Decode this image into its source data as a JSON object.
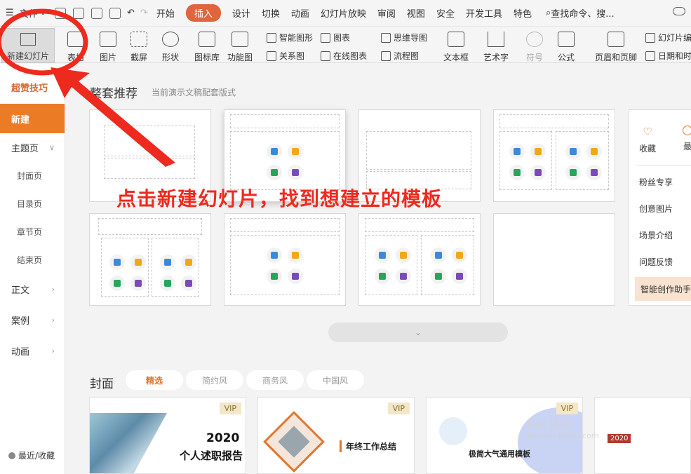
{
  "menubar": {
    "hamburger_label": "文件",
    "tabs": [
      "开始",
      "插入",
      "设计",
      "切换",
      "动画",
      "幻灯片放映",
      "审阅",
      "视图",
      "安全",
      "开发工具",
      "特色"
    ],
    "active_tab": "插入",
    "search_label": "查找命令、搜..."
  },
  "ribbon": {
    "new_slide": "新建幻灯片",
    "table": "表格",
    "picture": "图片",
    "screenshot": "截屏",
    "shape": "形状",
    "icon_lib": "图标库",
    "function_chart": "功能图",
    "smart_shape": "智能图形",
    "relation": "关系图",
    "chart": "图表",
    "online_chart": "在线图表",
    "mindmap": "思维导图",
    "flowchart": "流程图",
    "textbox": "文本框",
    "art_text": "艺术字",
    "symbol": "符号",
    "formula": "公式",
    "header_footer": "页眉和页脚",
    "slide_num": "幻灯片编",
    "date_time": "日期和时"
  },
  "sidebar": {
    "head": "超赞技巧",
    "new": "新建",
    "theme_page": "主题页",
    "subs": [
      "封面页",
      "目录页",
      "章节页",
      "结束页"
    ],
    "body": "正文",
    "case": "案例",
    "animation": "动画",
    "recent": "最近/收藏"
  },
  "main": {
    "section_title": "整套推荐",
    "section_sub": "当前演示文稿配套版式",
    "panel": {
      "fav": "收藏",
      "more": "最",
      "items": [
        "粉丝专享",
        "创意图片",
        "场景介绍",
        "问题反馈"
      ],
      "ai": "智能创作助手"
    },
    "expand_icon": "chevron-down-icon",
    "cover_title": "封面",
    "filters": [
      "精选",
      "简约风",
      "商务风",
      "中国风"
    ],
    "vip": "VIP",
    "tpl1_year": "2020",
    "tpl1_sub": "个人述职报告",
    "tpl2_title": "年终工作总结",
    "tpl3_title": "极简大气通用模板",
    "tpl4_badge": "2020"
  },
  "annotation": {
    "text": "点击新建幻灯片，找到想建立的模板",
    "color": "#ee2a1f"
  },
  "watermark": {
    "text": "Bai 经验",
    "url": "jingyan.baidu.com"
  }
}
